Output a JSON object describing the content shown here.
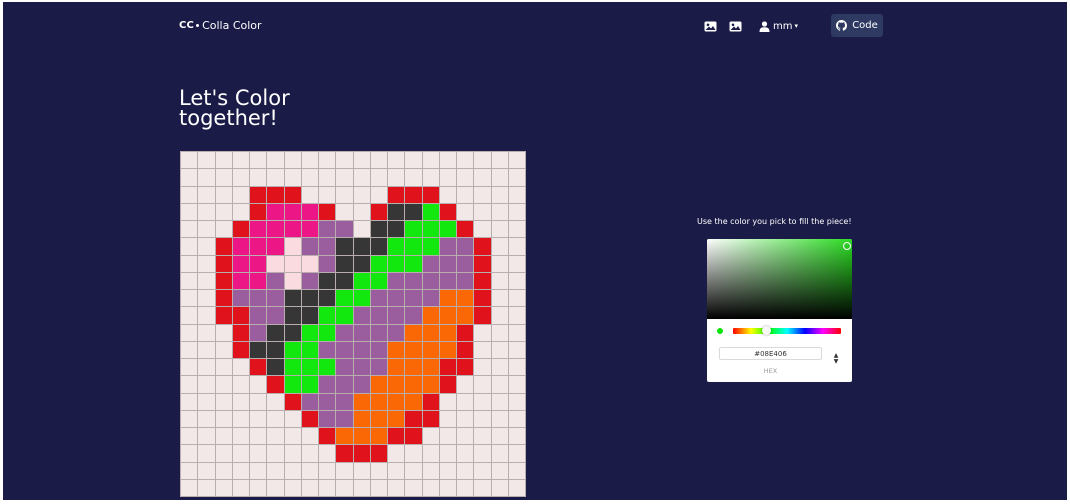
{
  "navbar": {
    "brand_mark": "CC",
    "brand_name": "Colla Color",
    "user_name": "mm",
    "code_button": "Code"
  },
  "heading": {
    "line1": "Let's Color",
    "line2": "together!"
  },
  "picker": {
    "hint": "Use the color you pick to fill the piece!",
    "hex_value": "#08E406",
    "hex_label": "HEX",
    "current_color": "#08e406"
  },
  "grid": {
    "size": 20,
    "palette": {
      ".": "#f2e8e8",
      "R": "#e0121b",
      "P": "#ec1687",
      "V": "#9a5d9d",
      "K": "#363636",
      "G": "#12e80d",
      "O": "#fa6806",
      "L": "#fadce0"
    },
    "rows": [
      "....................",
      "....................",
      "....RRR.....RRR.....",
      "....RPPPR..RKKGR....",
      "...RPPPPVV.KKGGGR...",
      "..RPPPLVVKKKGGGVVR..",
      "..RPPLLLVKKGGGVVVR..",
      "..RPPVLVKKGGVVVVVR..",
      "..RVVVKKKGGVVVVOOR..",
      "..RRVVKKGGVVVVOOOR..",
      "...RVKKGGVVVVOOOR...",
      "...RKKGGVVVVOOOOR...",
      "....RKGGGVVVOOORR...",
      ".....RGGVVVOOOOR....",
      "......RVVVOOOOR.....",
      ".......RVVOOORR.....",
      "........ROOORR......",
      ".........RRR........",
      "....................",
      "...................."
    ]
  }
}
